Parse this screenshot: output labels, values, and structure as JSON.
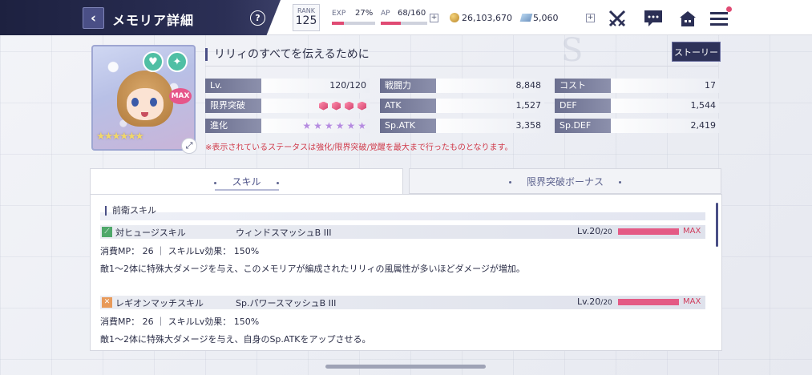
{
  "header": {
    "title": "メモリア詳細",
    "help": "?",
    "rank_label": "RANK",
    "rank_value": "125",
    "exp_label": "EXP",
    "exp_percent": "27%",
    "exp_fill": 0.27,
    "ap_label": "AP",
    "ap_value": "68/160",
    "ap_fill": 0.425,
    "plus": "+",
    "gold": "26,103,670",
    "gems": "5,060"
  },
  "card": {
    "max_label": "MAX",
    "stars": "★★★★★★",
    "expand": "⤢"
  },
  "memoria": {
    "name": "リリィのすべてを伝えるために",
    "story_button": "ストーリー"
  },
  "stats": {
    "col1": [
      {
        "key": "Lv.",
        "value": "120/120"
      },
      {
        "key": "限界突破",
        "value": ""
      },
      {
        "key": "進化",
        "value": ""
      }
    ],
    "col2": [
      {
        "key": "戦闘力",
        "value": "8,848"
      },
      {
        "key": "ATK",
        "value": "1,527"
      },
      {
        "key": "Sp.ATK",
        "value": "3,358"
      }
    ],
    "col3": [
      {
        "key": "コスト",
        "value": "17"
      },
      {
        "key": "DEF",
        "value": "1,544"
      },
      {
        "key": "Sp.DEF",
        "value": "2,419"
      }
    ],
    "limit_break_count": 4,
    "evolution_count": 6
  },
  "note": "※表示されているステータスは強化/限界突破/覚醒を最大まで行ったものとなります。",
  "tabs": {
    "skill": "スキル",
    "bonus": "限界突破ボーナス"
  },
  "panel": {
    "section_title": "前衛スキル",
    "skills": [
      {
        "type": "対ヒュージスキル",
        "name": "ウィンドスマッシュB III",
        "lv": "Lv.20",
        "lv_max": "/20",
        "max": "MAX",
        "meta": "消費MP：  26   ｜  スキルLv効果：   150%",
        "desc": "敵1～2体に特殊大ダメージを与え、このメモリアが編成されたリリィの風属性が多いほどダメージが増加。"
      },
      {
        "type": "レギオンマッチスキル",
        "name": "Sp.パワースマッシュB III",
        "lv": "Lv.20",
        "lv_max": "/20",
        "max": "MAX",
        "meta": "消費MP：  26   ｜  スキルLv効果：   150%",
        "desc": "敵1～2体に特殊大ダメージを与え、自身のSp.ATKをアップさせる。"
      }
    ]
  },
  "colors": {
    "accent": "#e04a73",
    "navy": "#2b2f55"
  }
}
